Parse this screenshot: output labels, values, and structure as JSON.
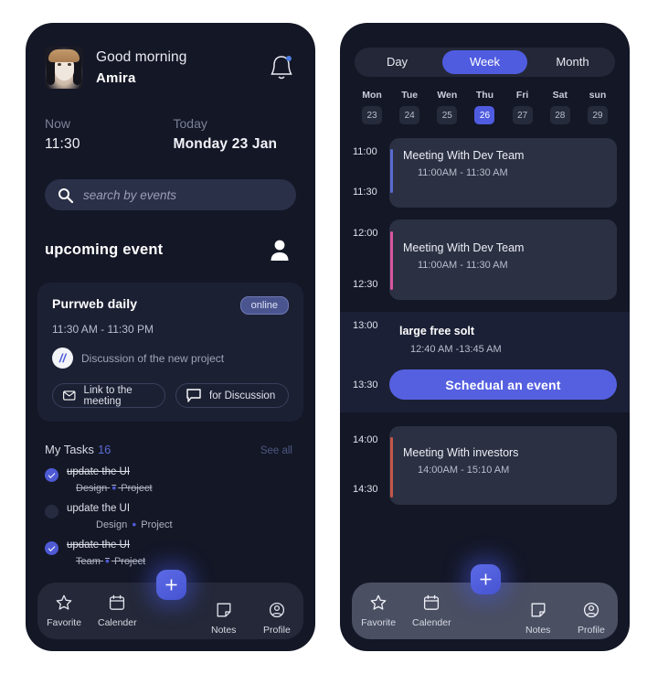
{
  "home": {
    "avatar_name": "user-avatar",
    "greeting": "Good morning",
    "username": "Amira",
    "bell_icon": "notification-bell-icon",
    "now_label": "Now",
    "now_value": "11:30",
    "today_label": "Today",
    "today_value": "Monday 23 Jan",
    "search": {
      "placeholder": "search by events",
      "icon": "search-icon"
    },
    "section_title": "upcoming event",
    "person_icon": "person-icon",
    "event": {
      "title": "Purrweb daily",
      "badge": "online",
      "time": "11:30 AM - 11:30 PM",
      "logo": "//",
      "description": "Discussion of the new project",
      "buttons": [
        {
          "label": "Link to the meeting",
          "icon": "mail-icon"
        },
        {
          "label": "for Discussion",
          "icon": "chat-bubble-icon"
        }
      ]
    },
    "tasks": {
      "title": "My Tasks",
      "count": "16",
      "see_all": "See all",
      "items": [
        {
          "name": "update the UI",
          "group": "Design",
          "project": "Project",
          "done": true
        },
        {
          "name": "update the UI",
          "group": "Design",
          "project": "Project",
          "done": false
        },
        {
          "name": "update the UI",
          "group": "Team",
          "project": "Project",
          "done": true
        }
      ]
    }
  },
  "calendar": {
    "views": [
      {
        "label": "Day",
        "active": false
      },
      {
        "label": "Week",
        "active": true
      },
      {
        "label": "Month",
        "active": false
      }
    ],
    "days": [
      {
        "name": "Mon",
        "num": "23",
        "selected": false
      },
      {
        "name": "Tue",
        "num": "24",
        "selected": false
      },
      {
        "name": "Wen",
        "num": "25",
        "selected": false
      },
      {
        "name": "Thu",
        "num": "26",
        "selected": true
      },
      {
        "name": "Fri",
        "num": "27",
        "selected": false
      },
      {
        "name": "Sat",
        "num": "28",
        "selected": false
      },
      {
        "name": "sun",
        "num": "29",
        "selected": false
      }
    ],
    "slots": [
      {
        "start": "11:00",
        "end": "11:30",
        "title": "Meeting With Dev Team",
        "time": "11:00AM - 11:30 AM",
        "accent": "#5a6ad0"
      },
      {
        "start": "12:00",
        "end": "12:30",
        "title": "Meeting With Dev Team",
        "time": "11:00AM - 11:30 AM",
        "accent": "#d8569f"
      }
    ],
    "free_slot": {
      "start": "13:00",
      "end": "13:30",
      "title": "large free solt",
      "time": "12:40 AM -13:45 AM",
      "button": "Schedual an event"
    },
    "last_slot": {
      "start": "14:00",
      "end": "14:30",
      "title": "Meeting With investors",
      "time": "14:00AM - 15:10 AM",
      "accent": "#c4574a"
    }
  },
  "nav": {
    "items": [
      {
        "label": "Favorite",
        "icon": "star-icon"
      },
      {
        "label": "Calender",
        "icon": "calendar-icon"
      },
      {
        "label": "Notes",
        "icon": "note-icon"
      },
      {
        "label": "Profile",
        "icon": "profile-icon"
      }
    ],
    "fab": {
      "label": "+",
      "icon": "plus-icon"
    }
  },
  "colors": {
    "accent": "#4f5ce0",
    "page_bg": "#141726",
    "card_bg": "#1c2033"
  }
}
